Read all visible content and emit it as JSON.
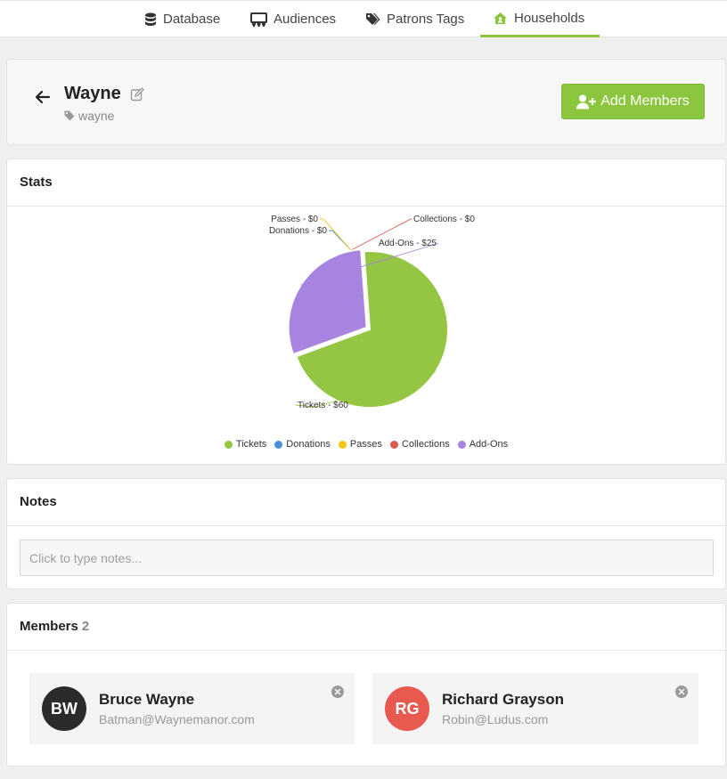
{
  "nav": {
    "tabs": [
      {
        "label": "Database",
        "icon": "database-icon",
        "active": false
      },
      {
        "label": "Audiences",
        "icon": "audience-icon",
        "active": false
      },
      {
        "label": "Patrons Tags",
        "icon": "tags-icon",
        "active": false
      },
      {
        "label": "Households",
        "icon": "house-icon",
        "active": true
      }
    ]
  },
  "header": {
    "name": "Wayne",
    "tag": "wayne",
    "add_members_label": "Add Members"
  },
  "stats": {
    "title": "Stats"
  },
  "chart_data": {
    "type": "pie",
    "slices": [
      {
        "label": "Tickets",
        "value": 60,
        "text": "Tickets - $60",
        "color": "#94c543"
      },
      {
        "label": "Donations",
        "value": 0,
        "text": "Donations - $0",
        "color": "#4a90d9"
      },
      {
        "label": "Passes",
        "value": 0,
        "text": "Passes - $0",
        "color": "#f5c518"
      },
      {
        "label": "Collections",
        "value": 0,
        "text": "Collections - $0",
        "color": "#e05a53"
      },
      {
        "label": "Add-Ons",
        "value": 25,
        "text": "Add-Ons - $25",
        "color": "#a784e0"
      }
    ],
    "legend": [
      "Tickets",
      "Donations",
      "Passes",
      "Collections",
      "Add-Ons"
    ],
    "legend_position": "bottom"
  },
  "notes": {
    "title": "Notes",
    "placeholder": "Click to type notes..."
  },
  "members": {
    "title": "Members",
    "count": "2",
    "list": [
      {
        "initials": "BW",
        "name": "Bruce Wayne",
        "email": "Batman@Waynemanor.com",
        "color": "#2b2b2b"
      },
      {
        "initials": "RG",
        "name": "Richard Grayson",
        "email": "Robin@Ludus.com",
        "color": "#e85a4f"
      }
    ]
  }
}
